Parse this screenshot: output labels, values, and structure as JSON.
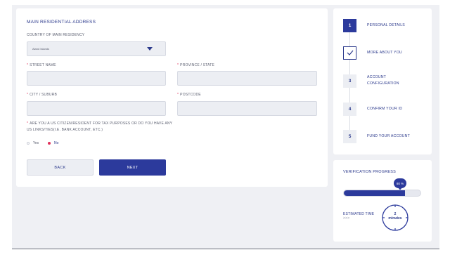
{
  "form": {
    "section_title": "MAIN RESIDENTIAL ADDRESS",
    "country": {
      "label": "COUNTRY OF MAIN RESIDENCY",
      "value": "Aland Islands"
    },
    "street": {
      "label": "STREET NAME",
      "value": ""
    },
    "province": {
      "label": "PROVINCE / STATE",
      "value": ""
    },
    "city": {
      "label": "CITY / SUBURB",
      "value": ""
    },
    "postcode": {
      "label": "POSTCODE",
      "value": ""
    },
    "required_marker": "*",
    "question": "ARE YOU A US CITIZEN/RESIDENT FOR TAX PURPOSES OR DO YOU HAVE ANY US LINKS/TIES(I.E. BANK ACCOUNT, ETC.)",
    "options": {
      "yes": "Yes",
      "no": "No",
      "selected": "No"
    },
    "back_label": "BACK",
    "next_label": "NEXT"
  },
  "steps": [
    {
      "number": "1",
      "label": "PERSONAL DETAILS",
      "state": "active"
    },
    {
      "number": "",
      "label": "MORE ABOUT YOU",
      "state": "done",
      "icon": "check-icon"
    },
    {
      "number": "3",
      "label": "ACCOUNT CONFIGURATION",
      "state": "pending"
    },
    {
      "number": "4",
      "label": "CONFIRM YOUR ID",
      "state": "pending"
    },
    {
      "number": "5",
      "label": "FUND YOUR ACCOUNT",
      "state": "pending"
    }
  ],
  "progress": {
    "title": "VERIFICATION PROGRESS",
    "percent": 80,
    "percent_label": "80 %",
    "estimated_label": "ESTIMATED TIME",
    "estimated_sub": ">>>",
    "time_value": "2",
    "time_unit": "minutes"
  },
  "colors": {
    "accent": "#2c3a9c",
    "required": "#e0305a",
    "background": "#eff0f4"
  }
}
